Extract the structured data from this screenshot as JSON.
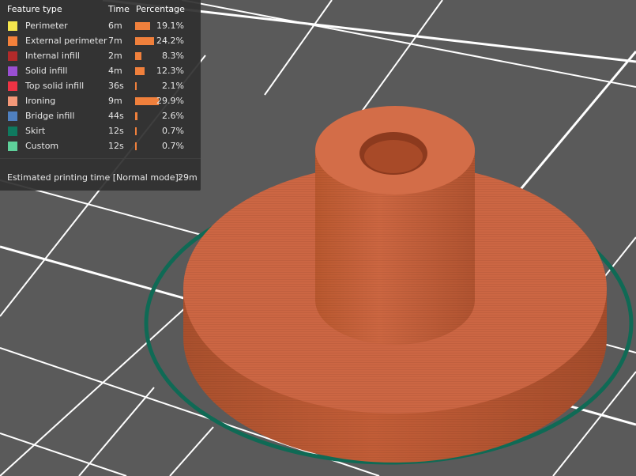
{
  "legend": {
    "headers": {
      "feature": "Feature type",
      "time": "Time",
      "percentage": "Percentage"
    },
    "bar_color": "#f0803c",
    "rows": [
      {
        "label": "Perimeter",
        "time": "6m",
        "percent": "19.1%",
        "value": 19.1,
        "color": "#f5e64d"
      },
      {
        "label": "External perimeter",
        "time": "7m",
        "percent": "24.2%",
        "value": 24.2,
        "color": "#f4813b"
      },
      {
        "label": "Internal infill",
        "time": "2m",
        "percent": "8.3%",
        "value": 8.3,
        "color": "#b22a2a"
      },
      {
        "label": "Solid infill",
        "time": "4m",
        "percent": "12.3%",
        "value": 12.3,
        "color": "#9a4fd2"
      },
      {
        "label": "Top solid infill",
        "time": "36s",
        "percent": "2.1%",
        "value": 2.1,
        "color": "#ee3344"
      },
      {
        "label": "Ironing",
        "time": "9m",
        "percent": "29.9%",
        "value": 29.9,
        "color": "#f39878"
      },
      {
        "label": "Bridge infill",
        "time": "44s",
        "percent": "2.6%",
        "value": 2.6,
        "color": "#4f80c0"
      },
      {
        "label": "Skirt",
        "time": "12s",
        "percent": "0.7%",
        "value": 0.7,
        "color": "#0f7a5f"
      },
      {
        "label": "Custom",
        "time": "12s",
        "percent": "0.7%",
        "value": 0.7,
        "color": "#5ed09a"
      }
    ],
    "estimate_label": "Estimated printing time [Normal mode]:",
    "estimate_value": "29m"
  },
  "scene": {
    "background": "#5a5a5a",
    "grid_color": "#ffffff",
    "model_color": "#c8633e",
    "skirt_color": "#0f6a55"
  }
}
